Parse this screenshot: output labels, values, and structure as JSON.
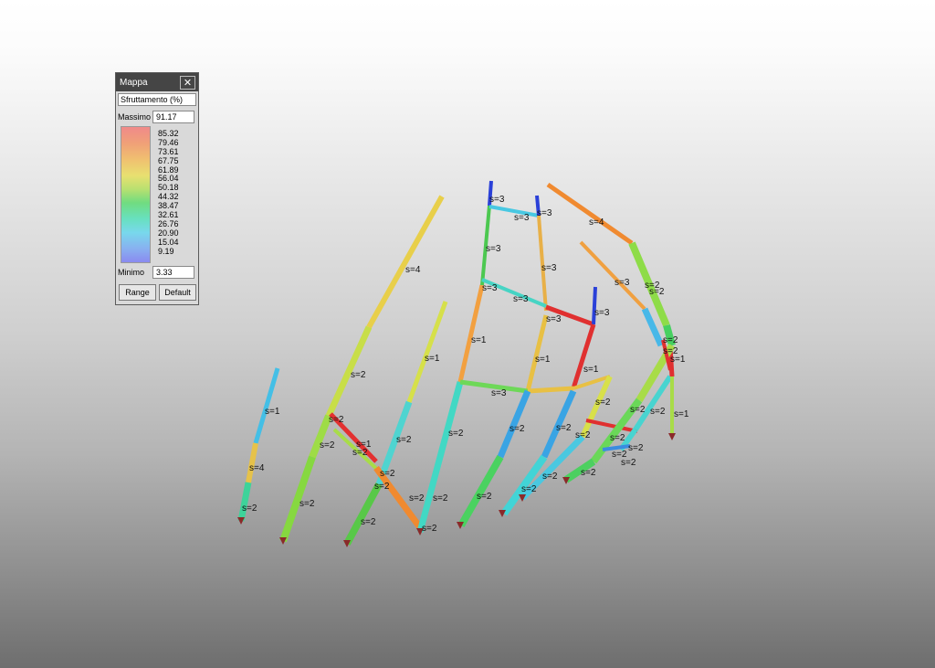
{
  "panel": {
    "title": "Mappa",
    "selected": "Sfruttamento (%)",
    "max_label": "Massimo",
    "max_value": "91.17",
    "min_label": "Minimo",
    "min_value": "3.33",
    "ticks": [
      "85.32",
      "79.46",
      "73.61",
      "67.75",
      "61.89",
      "56.04",
      "50.18",
      "44.32",
      "38.47",
      "32.61",
      "26.76",
      "20.90",
      "15.04",
      "9.19"
    ],
    "range_label": "Range",
    "default_label": "Default"
  },
  "scene": {
    "labels": [
      "s=3",
      "s=3",
      "s=3",
      "s=4",
      "s=3",
      "s=3",
      "s=4",
      "s=3",
      "s=3",
      "s=2",
      "s=3",
      "s=3",
      "s=1",
      "s=1",
      "s=1",
      "s=3",
      "s=1",
      "s=2",
      "s=2",
      "s=3",
      "s=2",
      "s=2",
      "s=2",
      "s=2",
      "s=1",
      "s=2",
      "s=2",
      "s=2",
      "s=1",
      "s=2",
      "s=4",
      "s=2",
      "s=2",
      "s=2",
      "s=2",
      "s=2",
      "s=2",
      "s=2",
      "s=2",
      "s=2",
      "s=2",
      "s=2",
      "s=2",
      "s=2",
      "s=2",
      "s=2",
      "s=2",
      "s=2",
      "s=1",
      "s=2",
      "s=2",
      "s=2",
      "s=2",
      "s=1"
    ]
  }
}
